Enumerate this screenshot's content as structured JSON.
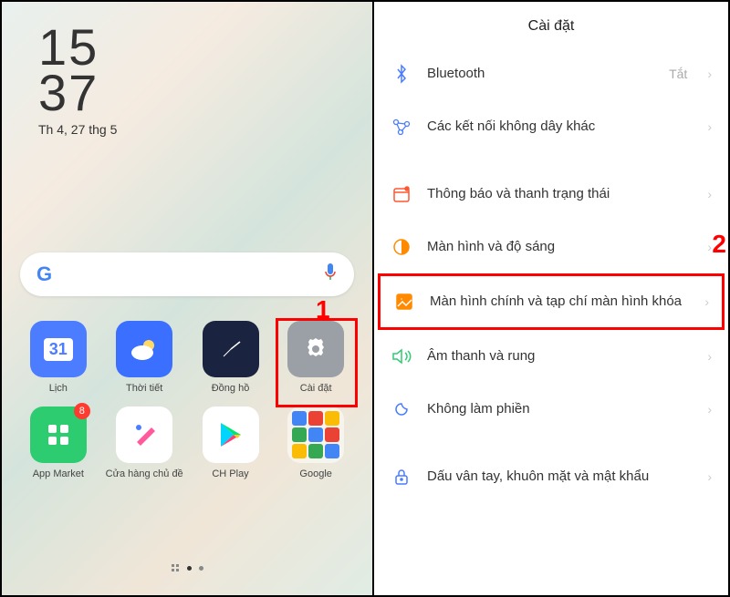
{
  "homescreen": {
    "clock_hours": "15",
    "clock_minutes": "37",
    "date": "Th 4, 27 thg 5",
    "apps": [
      {
        "label": "Lịch",
        "icon": "calendar"
      },
      {
        "label": "Thời tiết",
        "icon": "weather"
      },
      {
        "label": "Đồng hồ",
        "icon": "clock"
      },
      {
        "label": "Cài đặt",
        "icon": "settings"
      },
      {
        "label": "App Market",
        "icon": "appmarket",
        "badge": "8"
      },
      {
        "label": "Cửa hàng chủ đề",
        "icon": "themestore"
      },
      {
        "label": "CH Play",
        "icon": "playstore"
      },
      {
        "label": "Google",
        "icon": "googlefolder"
      }
    ],
    "marker1": "1"
  },
  "settings": {
    "title": "Cài đặt",
    "marker2": "2",
    "items": [
      {
        "label": "Bluetooth",
        "status": "Tắt",
        "icon": "bluetooth",
        "color": "#4a7cff"
      },
      {
        "label": "Các kết nối không dây khác",
        "icon": "wireless",
        "color": "#4a7cff"
      },
      {
        "label": "Thông báo và thanh trạng thái",
        "icon": "notification",
        "color": "#ff5630"
      },
      {
        "label": "Màn hình và độ sáng",
        "icon": "brightness",
        "color": "#ff8a00"
      },
      {
        "label": "Màn hình chính và tạp chí màn hình khóa",
        "icon": "homescreen",
        "color": "#ff8a00"
      },
      {
        "label": "Âm thanh và rung",
        "icon": "sound",
        "color": "#2ecc71"
      },
      {
        "label": "Không làm phiền",
        "icon": "dnd",
        "color": "#4a7cff"
      },
      {
        "label": "Dấu vân tay, khuôn mặt và mật khẩu",
        "icon": "security",
        "color": "#4a7cff"
      }
    ]
  }
}
